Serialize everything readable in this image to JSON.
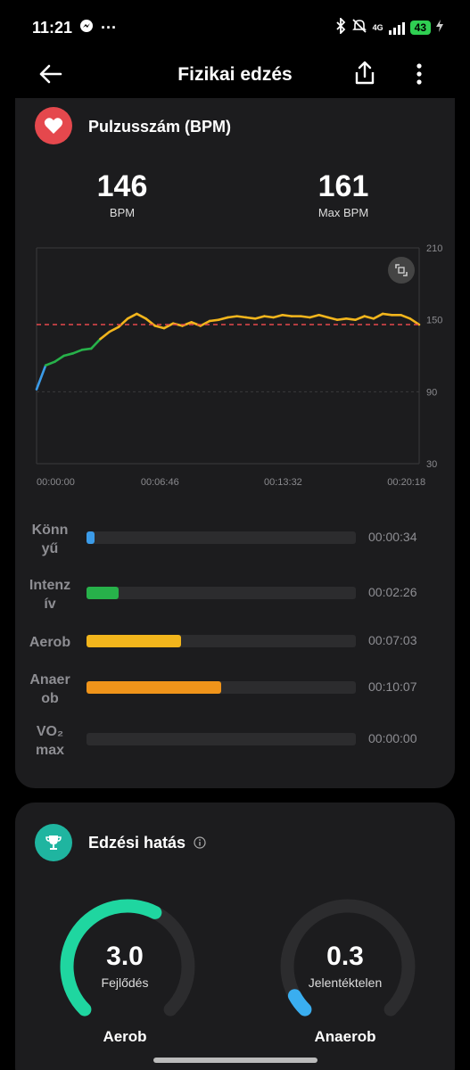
{
  "status_bar": {
    "time": "11:21",
    "dots": "···",
    "network": "4G",
    "battery": "43"
  },
  "app_bar": {
    "title": "Fizikai edzés"
  },
  "heart_rate": {
    "title": "Pulzusszám (BPM)",
    "avg_value": "146",
    "avg_unit": "BPM",
    "max_value": "161",
    "max_unit": "Max BPM"
  },
  "chart_data": {
    "type": "line",
    "title": "",
    "xlabel": "",
    "ylabel": "",
    "x_ticks": [
      "00:00:00",
      "00:06:46",
      "00:13:32",
      "00:20:18"
    ],
    "y_ticks": [
      "210",
      "150",
      "90",
      "30"
    ],
    "ylim": [
      30,
      210
    ],
    "reference_line": {
      "value": 146,
      "color": "#e5484d",
      "style": "dashed"
    },
    "series": [
      {
        "x_minutes": [
          0,
          0.5,
          1,
          1.5,
          2,
          2.5,
          3,
          3.5,
          4,
          4.5,
          5,
          5.5,
          6,
          6.5,
          7,
          7.5,
          8,
          8.5,
          9,
          9.5,
          10,
          10.5,
          11,
          11.5,
          12,
          12.5,
          13,
          13.5,
          14,
          14.5,
          15,
          15.5,
          16,
          16.5,
          17,
          17.5,
          18,
          18.5,
          19,
          19.5,
          20,
          20.5,
          21
        ],
        "bpm": [
          92,
          112,
          115,
          120,
          122,
          125,
          126,
          134,
          140,
          144,
          151,
          155,
          151,
          145,
          143,
          147,
          145,
          148,
          145,
          149,
          150,
          152,
          153,
          152,
          151,
          153,
          152,
          154,
          153,
          153,
          152,
          154,
          152,
          150,
          151,
          150,
          153,
          151,
          155,
          154,
          154,
          151,
          146
        ],
        "zone_colors": [
          "#3b9be8",
          "#27b14a",
          "#f2b51c",
          "#f0941a"
        ]
      }
    ]
  },
  "zones": [
    {
      "label_line1": "Könn",
      "label_line2": "yű",
      "time": "00:00:34",
      "fraction": 0.03,
      "color": "#3b9be8"
    },
    {
      "label_line1": "Intenz",
      "label_line2": "ív",
      "time": "00:02:26",
      "fraction": 0.12,
      "color": "#27b14a"
    },
    {
      "label_line1": "Aerob",
      "label_line2": "",
      "time": "00:07:03",
      "fraction": 0.35,
      "color": "#f2b51c"
    },
    {
      "label_line1": "Anaer",
      "label_line2": "ob",
      "time": "00:10:07",
      "fraction": 0.5,
      "color": "#f0941a"
    },
    {
      "label_line1": "VO₂",
      "label_line2": "max",
      "time": "00:00:00",
      "fraction": 0.0,
      "color": "#e5484d"
    }
  ],
  "effect": {
    "title": "Edzési hatás",
    "aerobic": {
      "value": "3.0",
      "status": "Fejlődés",
      "name": "Aerob",
      "fraction": 0.6,
      "color": "#1fd6a0"
    },
    "anaerobic": {
      "value": "0.3",
      "status": "Jelentéktelen",
      "name": "Anaerob",
      "fraction": 0.06,
      "color": "#3aaef0"
    }
  }
}
